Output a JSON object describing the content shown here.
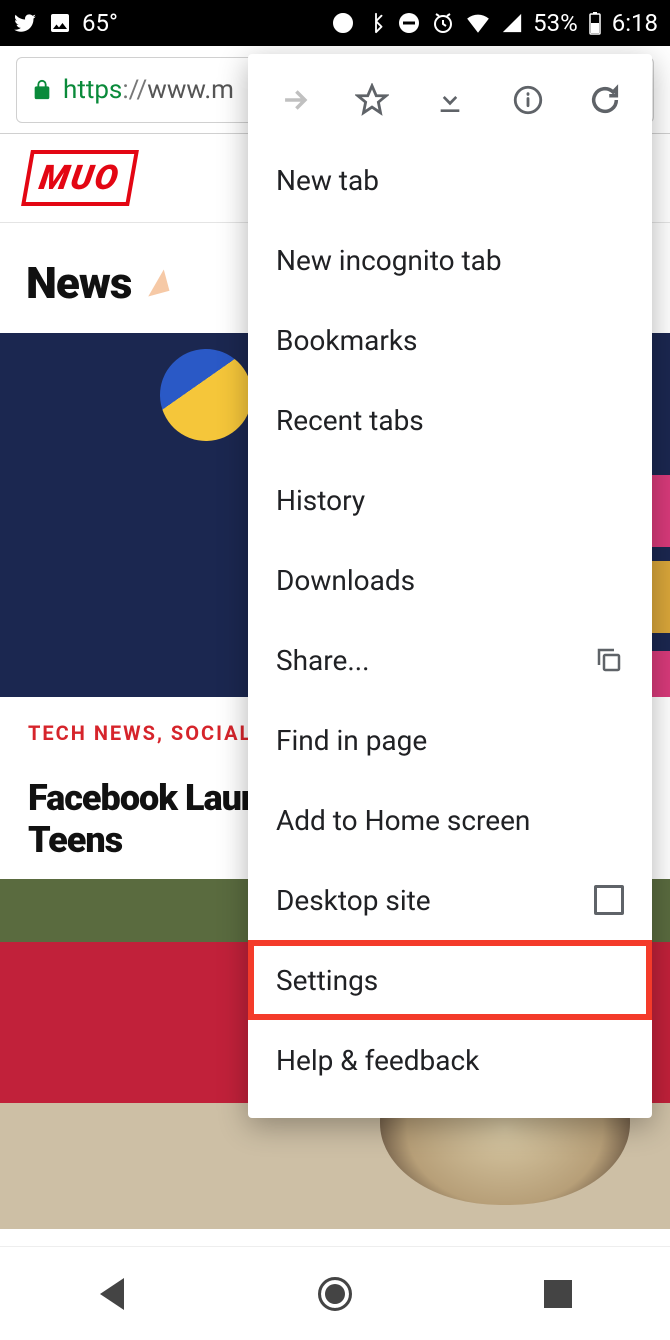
{
  "statusbar": {
    "temperature": "65°",
    "battery_percent": "53%",
    "clock": "6:18"
  },
  "addressbar": {
    "scheme": "https",
    "separator": "://",
    "visible_url_rest": "www.m"
  },
  "site": {
    "logo_text": "MUO",
    "section_title": "News",
    "categories": "TECH NEWS,  SOCIAL M",
    "headline": "Facebook Launches a Messenger for Teens"
  },
  "menu": {
    "items": {
      "new_tab": "New tab",
      "new_incognito": "New incognito tab",
      "bookmarks": "Bookmarks",
      "recent_tabs": "Recent tabs",
      "history": "History",
      "downloads": "Downloads",
      "share": "Share...",
      "find_in_page": "Find in page",
      "add_to_home": "Add to Home screen",
      "desktop_site": "Desktop site",
      "settings": "Settings",
      "help_feedback": "Help & feedback"
    }
  }
}
